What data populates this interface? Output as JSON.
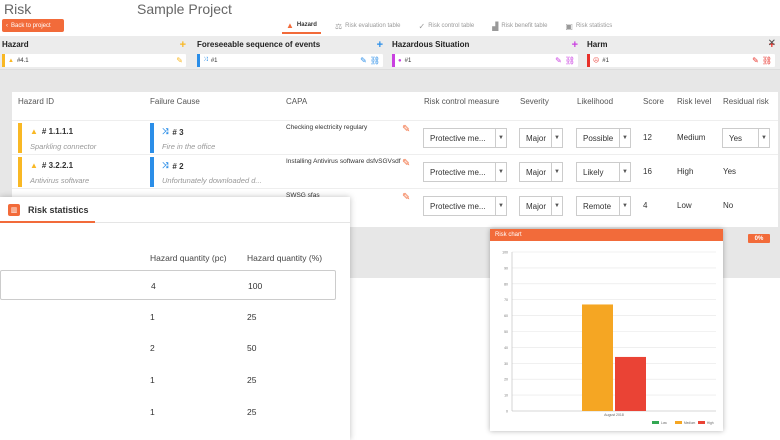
{
  "app": {
    "title": "Risk",
    "project": "Sample Project",
    "back_label": "Back to project"
  },
  "tabs": [
    {
      "label": "Hazard",
      "icon": "warning-icon",
      "active": true
    },
    {
      "label": "Risk evaluation table",
      "icon": "scale-icon",
      "active": false
    },
    {
      "label": "Risk control table",
      "icon": "shield-check-icon",
      "active": false
    },
    {
      "label": "Risk benefit table",
      "icon": "bar-graph-icon",
      "active": false
    },
    {
      "label": "Risk statistics",
      "icon": "statistics-icon",
      "active": false
    }
  ],
  "chain": [
    {
      "label": "Hazard",
      "value": "#4.1",
      "color": "#f9b824",
      "icon": "warning-icon"
    },
    {
      "label": "Foreseeable sequence of events",
      "value": "#1",
      "color": "#2b8ee8",
      "icon": "shuffle-icon"
    },
    {
      "label": "Hazardous Situation",
      "value": "#1",
      "color": "#c93fe0",
      "icon": "alert-circle-icon"
    },
    {
      "label": "Harm",
      "value": "#1",
      "color": "#e8312a",
      "icon": "sad-face-icon"
    }
  ],
  "grid": {
    "headers": [
      "Hazard ID",
      "Failure Cause",
      "CAPA",
      "Risk control measure",
      "Severity",
      "Likelihood",
      "Score",
      "Risk level",
      "Residual risk"
    ],
    "rows": [
      {
        "hazard_id": "# 1.1.1.1",
        "hazard_desc": "Sparkling connector",
        "cause_id": "# 3",
        "cause_desc": "Fire in the office",
        "capa": "Checking electricity regulary",
        "measure": "Protective me...",
        "severity": "Major",
        "likelihood": "Possible",
        "score": "12",
        "level": "Medium",
        "residual": "Yes"
      },
      {
        "hazard_id": "# 3.2.2.1",
        "hazard_desc": "Antivirus software",
        "cause_id": "# 2",
        "cause_desc": "Unfortunately downloaded d...",
        "capa": "Installing Antivirus software dsfvSGVsdf",
        "measure": "Protective me...",
        "severity": "Major",
        "likelihood": "Likely",
        "score": "16",
        "level": "High",
        "residual": "Yes"
      },
      {
        "hazard_id": "",
        "hazard_desc": "",
        "cause_id": "",
        "cause_desc": "",
        "capa": "SWSG sfas",
        "measure": "Protective me...",
        "severity": "Major",
        "likelihood": "Remote",
        "score": "4",
        "level": "Low",
        "residual": "No"
      }
    ]
  },
  "progress": 0,
  "progress_label": "0%",
  "stats": {
    "title": "Risk statistics",
    "col_qty": "Hazard quantity (pc)",
    "col_pct": "Hazard quantity (%)",
    "rows": [
      {
        "qty": "4",
        "pct": "100"
      },
      {
        "qty": "1",
        "pct": "25"
      },
      {
        "qty": "2",
        "pct": "50"
      },
      {
        "qty": "1",
        "pct": "25"
      },
      {
        "qty": "1",
        "pct": "25"
      }
    ]
  },
  "chart_data": {
    "type": "bar",
    "title": "Risk chart",
    "categories": [
      "August 2018"
    ],
    "series": [
      {
        "name": "Low",
        "color": "#33a853",
        "values": [
          0
        ]
      },
      {
        "name": "Medium",
        "color": "#f5a623",
        "values": [
          67
        ]
      },
      {
        "name": "High",
        "color": "#ea4335",
        "values": [
          34
        ]
      }
    ],
    "ylim": [
      0,
      100
    ],
    "yticks": [
      0,
      10,
      20,
      30,
      40,
      50,
      60,
      70,
      80,
      90,
      100
    ],
    "grid": true,
    "legend": "bottom-right"
  }
}
